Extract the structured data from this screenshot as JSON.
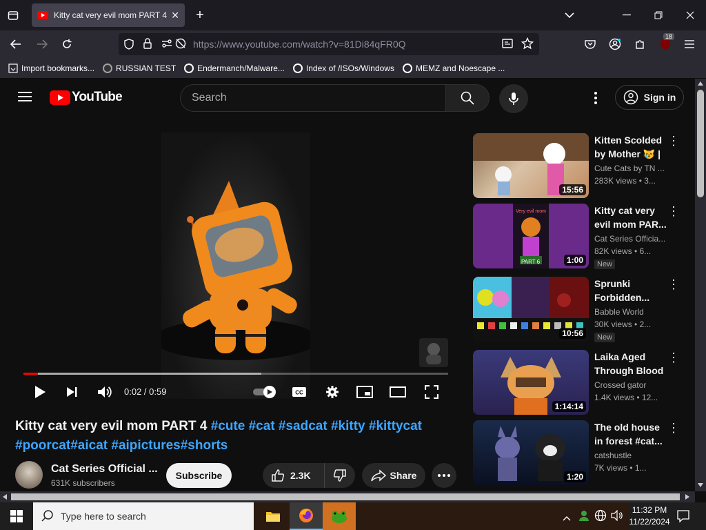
{
  "browser": {
    "tab_title": "Kitty cat very evil mom PART 4",
    "url": "https://www.youtube.com/watch?v=81Di84qFR0Q",
    "extension_badge": "18",
    "bookmarks": [
      "Import bookmarks...",
      "RUSSIAN TEST",
      "Endermanch/Malware...",
      "Index of /ISOs/Windows",
      "MEMZ and Noescape ..."
    ]
  },
  "youtube": {
    "logo_text": "YouTube",
    "search_placeholder": "Search",
    "signin_label": "Sign in"
  },
  "player": {
    "time": "0:02 / 0:59",
    "progress_played": 0.034,
    "progress_loaded": 0.56
  },
  "video": {
    "title_main": "Kitty cat very evil mom PART 4 ",
    "title_tags_1": "#cute #cat #sadcat #kitty #kittycat",
    "title_tags_2": "#poorcat#aicat #aipictures#shorts",
    "channel": "Cat Series Official ...",
    "subscribers": "631K subscribers",
    "subscribe_label": "Subscribe",
    "likes": "2.3K",
    "share_label": "Share"
  },
  "recommendations": [
    {
      "title": "Kitten Scolded by Mother 😿 | ...",
      "channel": "Cute Cats by TN ...",
      "views": "283K views  • 3...",
      "duration": "15:56",
      "new": ""
    },
    {
      "title": "Kitty cat very evil mom PAR...",
      "channel": "Cat Series Officia...",
      "views": "82K views  • 6...",
      "duration": "1:00",
      "new": "New",
      "thumb_text_top": "Very evil mom",
      "thumb_text_bottom": "PART 6"
    },
    {
      "title": "Sprunki Forbidden...",
      "channel": "Babble World",
      "views": "30K views  • 2...",
      "duration": "10:56",
      "new": "New"
    },
    {
      "title": "Laika Aged Through Blood",
      "channel": "Crossed gator",
      "views": "1.4K views  • 12...",
      "duration": "1:14:14",
      "new": ""
    },
    {
      "title": "The old house in forest #cat...",
      "channel": "catshustle",
      "views": "7K views  • 1...",
      "duration": "1:20",
      "new": ""
    }
  ],
  "taskbar": {
    "search_placeholder": "Type here to search",
    "time": "11:32 PM",
    "date": "11/22/2024"
  }
}
